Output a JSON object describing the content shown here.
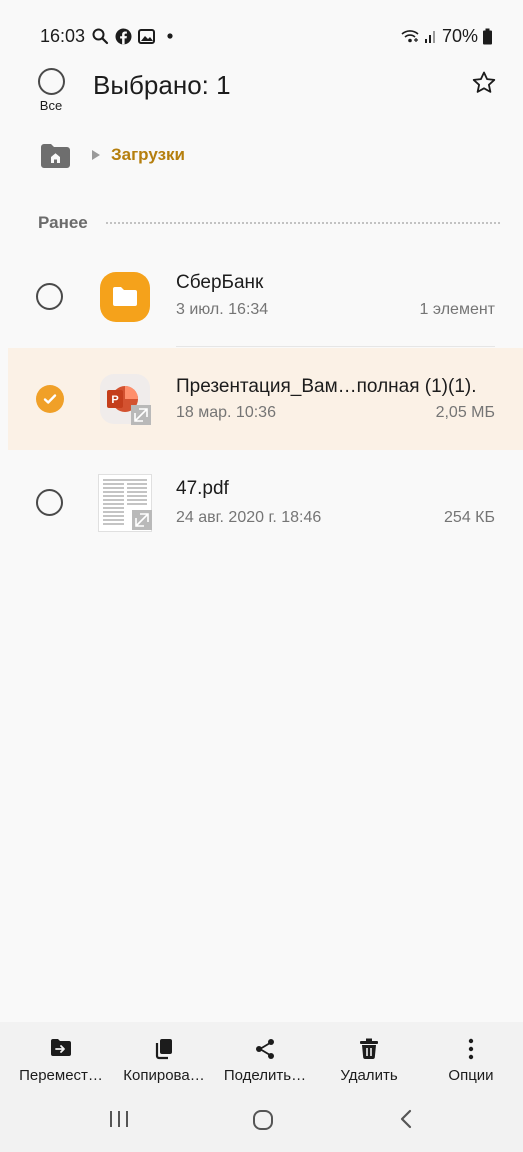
{
  "status_bar": {
    "time": "16:03",
    "battery": "70%",
    "icons": [
      "search-icon",
      "facebook-icon",
      "gallery-icon",
      "dot-icon",
      "wifi-icon",
      "signal-icon",
      "battery-icon"
    ]
  },
  "header": {
    "select_all_label": "Все",
    "title": "Выбрано: 1"
  },
  "breadcrumb": {
    "current": "Загрузки"
  },
  "section": {
    "label": "Ранее"
  },
  "files": [
    {
      "name": "СберБанк",
      "date": "3 июл. 16:34",
      "size": "1 элемент",
      "icon": "folder-icon",
      "selected": false
    },
    {
      "name": "Презентация_Вам…полная (1)(1).",
      "date": "18 мар. 10:36",
      "size": "2,05 МБ",
      "icon": "powerpoint-icon",
      "selected": true
    },
    {
      "name": "47.pdf",
      "date": "24 авг. 2020 г. 18:46",
      "size": "254 КБ",
      "icon": "pdf-thumbnail-icon",
      "selected": false
    }
  ],
  "actions": [
    {
      "label": "Перемест…",
      "icon": "move-icon"
    },
    {
      "label": "Копирова…",
      "icon": "copy-icon"
    },
    {
      "label": "Поделить…",
      "icon": "share-icon"
    },
    {
      "label": "Удалить",
      "icon": "delete-icon"
    },
    {
      "label": "Опции",
      "icon": "more-options-icon"
    }
  ],
  "colors": {
    "accent": "#f0a028",
    "breadcrumb": "#b57f0e",
    "selected_row": "#fbf1e6",
    "folder": "#f5a21b"
  }
}
